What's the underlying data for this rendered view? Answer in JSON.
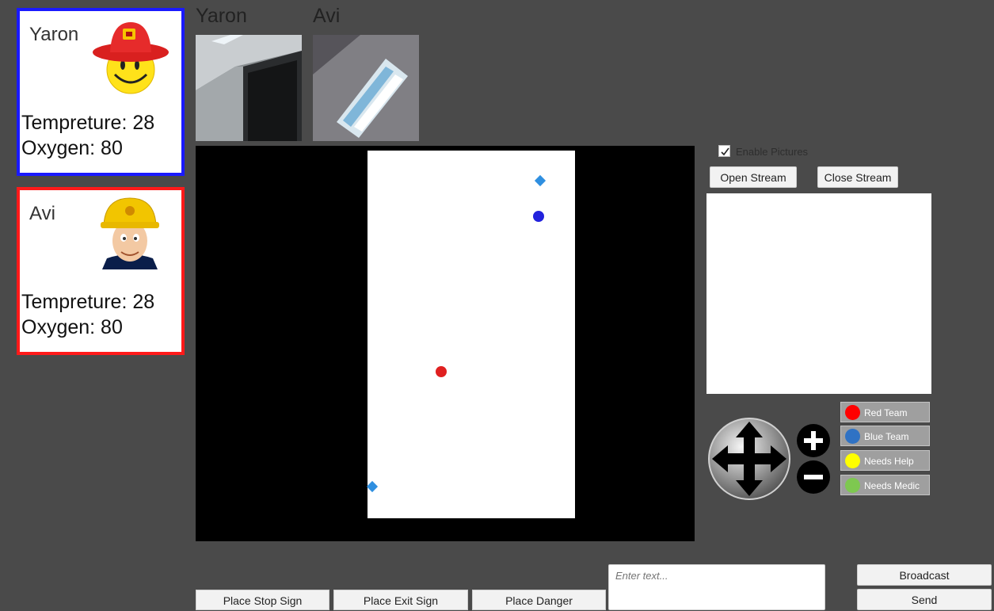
{
  "members": [
    {
      "name": "Yaron",
      "temperature": "Tempreture: 28",
      "oxygen": "Oxygen: 80",
      "border": "#1a1aff",
      "avatar": "smiley-firefighter-avatar"
    },
    {
      "name": "Avi",
      "temperature": "Tempreture: 28",
      "oxygen": "Oxygen: 80",
      "border": "#ff1a1a",
      "avatar": "fireman-sam-avatar"
    }
  ],
  "cameras": [
    {
      "label": "Yaron"
    },
    {
      "label": "Avi"
    }
  ],
  "map": {
    "markers": [
      {
        "type": "diamond",
        "color": "#2f8fe0"
      },
      {
        "type": "dot",
        "color": "#2222dd"
      },
      {
        "type": "dot",
        "color": "#e02020"
      },
      {
        "type": "diamond",
        "color": "#2f8fe0"
      }
    ]
  },
  "stream": {
    "enable_pictures_label": "Enable Pictures",
    "enable_pictures_checked": true,
    "open_label": "Open Stream",
    "close_label": "Close Stream"
  },
  "legend": [
    {
      "label": "Red Team",
      "color": "#ff0000"
    },
    {
      "label": "Blue Team",
      "color": "#2f72c4"
    },
    {
      "label": "Needs Help",
      "color": "#ffff00"
    },
    {
      "label": "Needs Medic",
      "color": "#7ec850"
    }
  ],
  "zoom": {
    "in_icon": "plus-icon",
    "out_icon": "minus-icon"
  },
  "pan_icon": "move-arrows-icon",
  "actions": {
    "place_stop_sign": "Place Stop Sign",
    "place_exit_sign": "Place Exit Sign",
    "place_danger": "Place Danger"
  },
  "message": {
    "placeholder": "Enter text...",
    "value": "",
    "broadcast_label": "Broadcast",
    "send_label": "Send"
  }
}
